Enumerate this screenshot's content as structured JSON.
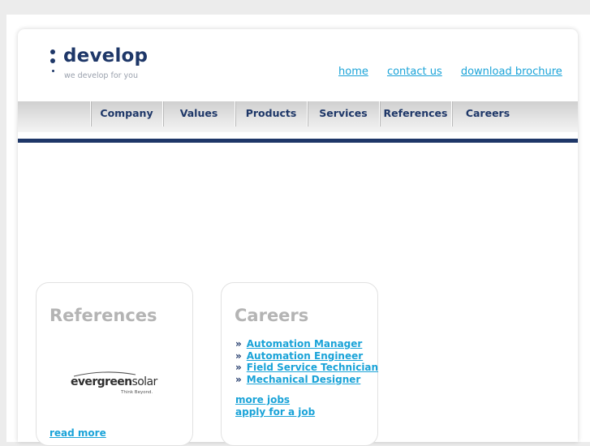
{
  "logo": {
    "name": "develop",
    "tagline": "we develop for you"
  },
  "toplinks": [
    "home",
    "contact us",
    "download brochure"
  ],
  "nav": [
    "Company",
    "Values",
    "Products",
    "Services",
    "References",
    "Careers"
  ],
  "colors": {
    "brand": "#1e3768",
    "link": "#1aa3d8",
    "box_title": "#b4b4b4"
  },
  "references": {
    "title": "References",
    "logo_word_regular": "evergreen",
    "logo_word_light": "solar",
    "logo_tagline": "Think Beyond.",
    "read_more": "read more"
  },
  "careers": {
    "title": "Careers",
    "bullet": "»",
    "jobs": [
      "Automation Manager ",
      "Automation Engineer ",
      "Field Service Technician",
      "Mechanical Designer"
    ],
    "more_jobs": "more jobs ",
    "apply": "apply for a job"
  }
}
